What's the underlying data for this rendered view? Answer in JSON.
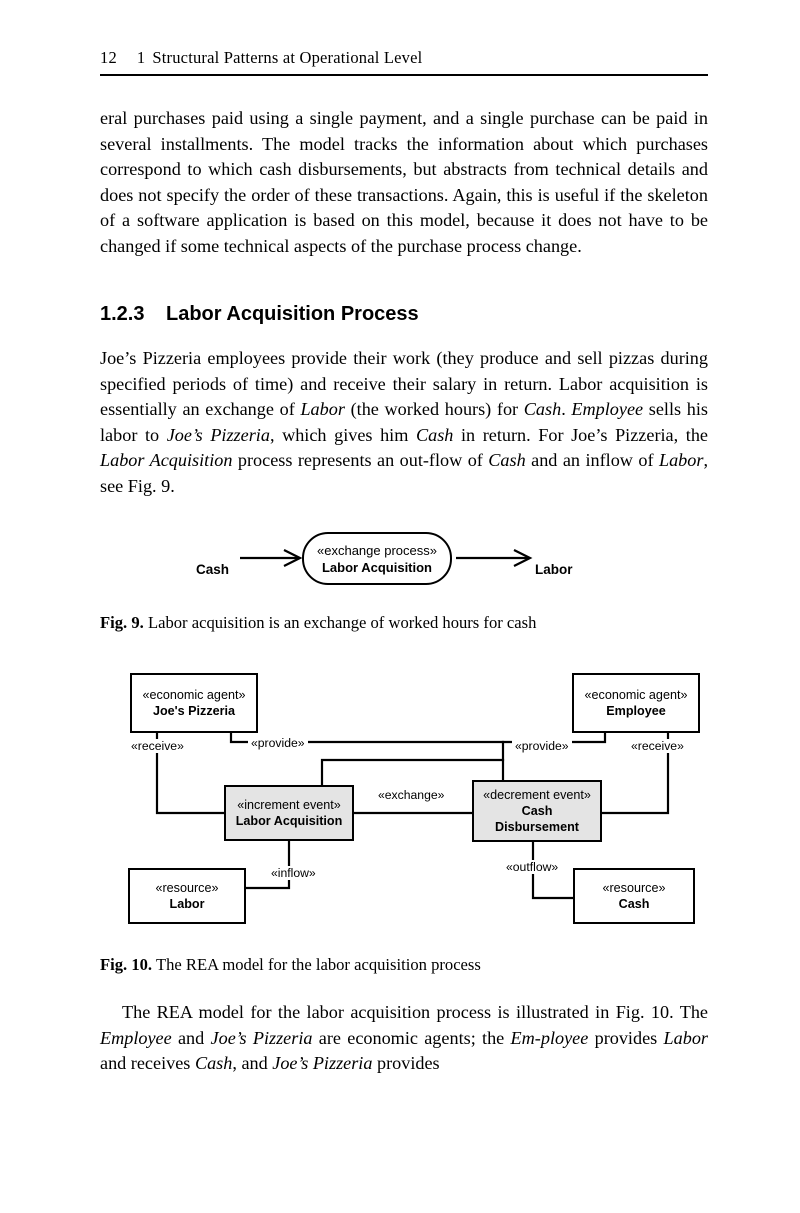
{
  "header": {
    "page_number": "12",
    "chapter_number": "1",
    "chapter_title": "Structural Patterns at Operational Level"
  },
  "section": {
    "number": "1.2.3",
    "title": "Labor Acquisition Process"
  },
  "paragraphs": {
    "p1": "eral purchases paid using a single payment, and a single purchase can be paid in several installments. The model tracks the information about which purchases correspond to which cash disbursements, but abstracts from technical details and does not specify the order of these transactions. Again, this is useful if the skeleton of a software application is based on this model, because it does not have to be changed if some technical aspects of the purchase process change."
  },
  "figures": {
    "fig9": {
      "caption_label": "Fig. 9.",
      "caption_text": "Labor acquisition is an exchange of worked hours for cash",
      "input_label": "Cash",
      "output_label": "Labor",
      "process": {
        "stereotype": "«exchange process»",
        "name": "Labor Acquisition"
      }
    },
    "fig10": {
      "caption_label": "Fig. 10.",
      "caption_text": "The REA model for the labor acquisition process",
      "nodes": {
        "joes_pizzeria": {
          "stereotype": "«economic agent»",
          "name": "Joe's Pizzeria"
        },
        "employee": {
          "stereotype": "«economic agent»",
          "name": "Employee"
        },
        "labor_acquisition": {
          "stereotype": "«increment event»",
          "name": "Labor Acquisition"
        },
        "cash_disbursement": {
          "stereotype": "«decrement event»",
          "name_line1": "Cash",
          "name_line2": "Disbursement"
        },
        "resource_labor": {
          "stereotype": "«resource»",
          "name": "Labor"
        },
        "resource_cash": {
          "stereotype": "«resource»",
          "name": "Cash"
        }
      },
      "edges": {
        "receive_left": "«receive»",
        "provide_left": "«provide»",
        "provide_right": "«provide»",
        "receive_right": "«receive»",
        "exchange": "«exchange»",
        "inflow": "«inflow»",
        "outflow": "«outflow»"
      },
      "colors": {
        "event_fill": "#e4e4e4",
        "node_stroke": "#000000",
        "page_background": "#ffffff"
      }
    }
  }
}
